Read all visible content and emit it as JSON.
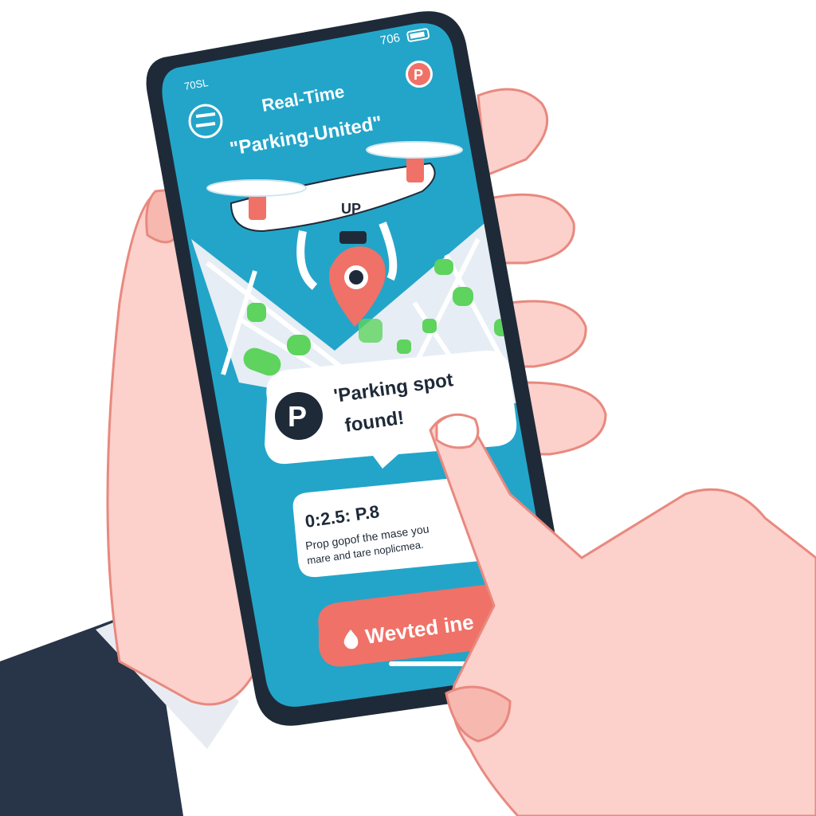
{
  "status_bar": {
    "left_time": "70SL",
    "right_time": "706"
  },
  "header": {
    "title_line1": "Real-Time",
    "title_line2": "\"Parking-United\"",
    "badge": "P"
  },
  "drone": {
    "label": "UP"
  },
  "notification": {
    "icon_letter": "P",
    "line1": "'Parking spot",
    "line2": "found!"
  },
  "info_card": {
    "timer": "0:2.5: P.8",
    "line1": "Prop gopof the mase you",
    "line2": "mare and tare noplicmea."
  },
  "action_button": {
    "label": "Wevted ine"
  },
  "colors": {
    "screen": "#23a5c9",
    "accent": "#f07167",
    "parking_green": "#5ed35e",
    "skin": "#fcd0cb",
    "suit": "#283447",
    "phone_frame": "#1f2a38"
  }
}
